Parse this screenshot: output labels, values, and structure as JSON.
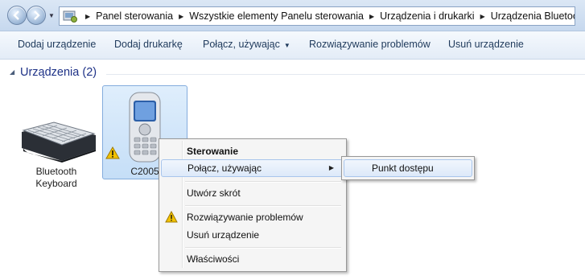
{
  "breadcrumb": {
    "items": [
      "Panel sterowania",
      "Wszystkie elementy Panelu sterowania",
      "Urządzenia i drukarki",
      "Urządzenia Bluetooth"
    ]
  },
  "toolbar": {
    "add_device": "Dodaj urządzenie",
    "add_printer": "Dodaj drukarkę",
    "connect_using": "Połącz, używając",
    "troubleshoot": "Rozwiązywanie problemów",
    "remove_device": "Usuń urządzenie"
  },
  "group": {
    "title": "Urządzenia (2)"
  },
  "devices": [
    {
      "label_line1": "Bluetooth",
      "label_line2": "Keyboard",
      "icon": "keyboard-icon"
    },
    {
      "label": "C2005",
      "icon": "mobile-phone-icon",
      "warning": true
    }
  ],
  "context_menu": {
    "control": "Sterowanie",
    "connect_using": "Połącz, używając",
    "create_shortcut": "Utwórz skrót",
    "troubleshoot": "Rozwiązywanie problemów",
    "remove_device": "Usuń urządzenie",
    "properties": "Właściwości"
  },
  "submenu": {
    "access_point": "Punkt dostępu"
  },
  "colors": {
    "accent": "#1e3287",
    "selection": "#c5def7",
    "warning": "#f2c200"
  }
}
